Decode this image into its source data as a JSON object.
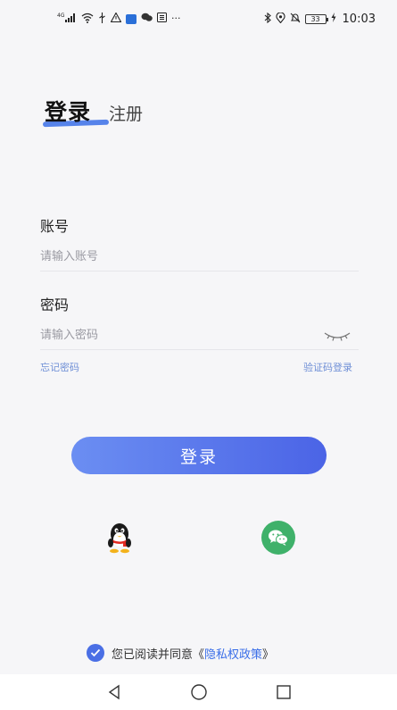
{
  "status_bar": {
    "network": "4G",
    "battery": "33",
    "time": "10:03",
    "icons_left": [
      "signal-icon",
      "wifi-icon",
      "usb-icon",
      "warning-icon",
      "app-notification-icon",
      "chat-icon",
      "news-icon",
      "more-icon"
    ],
    "icons_right": [
      "bluetooth-icon",
      "location-icon",
      "mute-icon",
      "battery-icon",
      "charging-icon"
    ],
    "more": "···"
  },
  "tabs": {
    "login": "登录",
    "register": "注册"
  },
  "account": {
    "label": "账号",
    "placeholder": "请输入账号"
  },
  "password": {
    "label": "密码",
    "placeholder": "请输入密码"
  },
  "links": {
    "forgot_password": "忘记密码",
    "code_login": "验证码登录"
  },
  "login_button": "登录",
  "social": {
    "qq": "qq-icon",
    "wechat": "wechat-icon"
  },
  "agreement": {
    "prefix": "您已阅读并同意",
    "open_bracket": "《",
    "policy": "隐私权政策",
    "close_bracket": "》",
    "checked": true
  },
  "colors": {
    "accent": "#4b64e6",
    "link": "#6f8fd6",
    "wechat": "#3fb16a",
    "background": "#f6f6f8"
  }
}
